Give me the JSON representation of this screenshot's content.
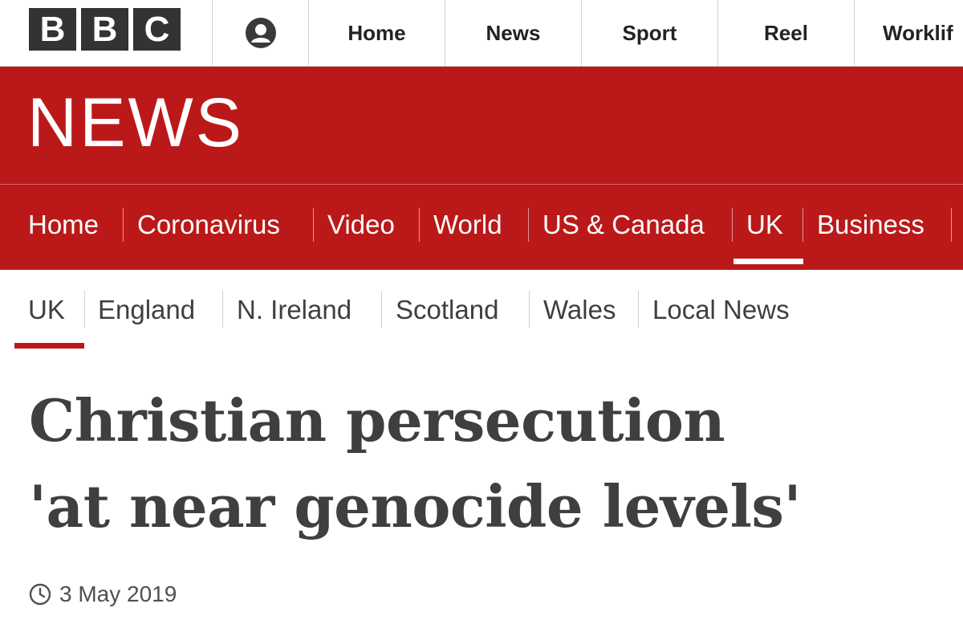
{
  "brand": {
    "letters": [
      "B",
      "B",
      "C"
    ],
    "colors": {
      "block": "#333333",
      "red": "#bb1919",
      "headline": "#3f3f42"
    }
  },
  "account": {
    "icon": "account-icon"
  },
  "top_nav": [
    "Home",
    "News",
    "Sport",
    "Reel",
    "Worklif"
  ],
  "section_title": "NEWS",
  "primary_nav": [
    "Home",
    "Coronavirus",
    "Video",
    "World",
    "US & Canada",
    "UK",
    "Business"
  ],
  "primary_nav_active": "UK",
  "secondary_nav": [
    "UK",
    "England",
    "N. Ireland",
    "Scotland",
    "Wales",
    "Local News"
  ],
  "secondary_nav_active": "UK",
  "article": {
    "headline_line1": "Christian persecution",
    "headline_line2": "'at near genocide levels'",
    "date": "3 May 2019",
    "date_icon": "clock-icon"
  }
}
